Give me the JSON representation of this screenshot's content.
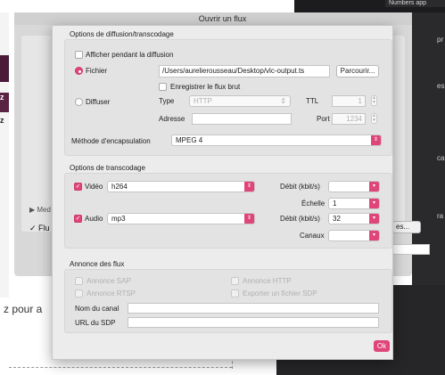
{
  "background": {
    "numbers_app": "Numbers app",
    "right_texts": [
      "pr",
      "es",
      "ca",
      "ra"
    ],
    "left_z1": "z",
    "left_z2": "z",
    "pour": "z pour a"
  },
  "underlying_dialog": {
    "med_label": "Med",
    "flu_label": "Flu",
    "es_button": "es..."
  },
  "sheet": {
    "title": "Ouvrir un flux",
    "diffusion": {
      "section_title": "Options de diffusion/transcodage",
      "afficher_label": "Afficher pendant la diffusion",
      "fichier_label": "Fichier",
      "fichier_path": "/Users/aurelierousseau/Desktop/vlc-output.ts",
      "parcourir_label": "Parcourir...",
      "enregistrer_label": "Enregistrer le flux brut",
      "diffuser_label": "Diffuser",
      "type_label": "Type",
      "type_value": "HTTP",
      "ttl_label": "TTL",
      "ttl_value": "1",
      "adresse_label": "Adresse",
      "port_label": "Port",
      "port_value": "1234",
      "encapsulation_label": "Méthode d'encapsulation",
      "encapsulation_value": "MPEG 4"
    },
    "transcodage": {
      "section_title": "Options de transcodage",
      "video_label": "Vidéo",
      "video_codec": "h264",
      "video_debit_label": "Débit (kbit/s)",
      "video_debit_value": "",
      "echelle_label": "Échelle",
      "echelle_value": "1",
      "audio_label": "Audio",
      "audio_codec": "mp3",
      "audio_debit_label": "Débit (kbit/s)",
      "audio_debit_value": "32",
      "canaux_label": "Canaux",
      "canaux_value": ""
    },
    "annonce": {
      "section_title": "Annonce des flux",
      "sap_label": "Annonce SAP",
      "http_label": "Annonce HTTP",
      "rtsp_label": "Annonce RTSP",
      "sdp_label": "Exporter un fichier SDP",
      "nom_canal_label": "Nom du canal",
      "nom_canal_value": "",
      "url_sdp_label": "URL du SDP",
      "url_sdp_value": ""
    },
    "ok_label": "Ok"
  },
  "colors": {
    "accent": "#e0457a",
    "sheet_bg": "#ececec",
    "group_bg": "#e3e3e3"
  }
}
